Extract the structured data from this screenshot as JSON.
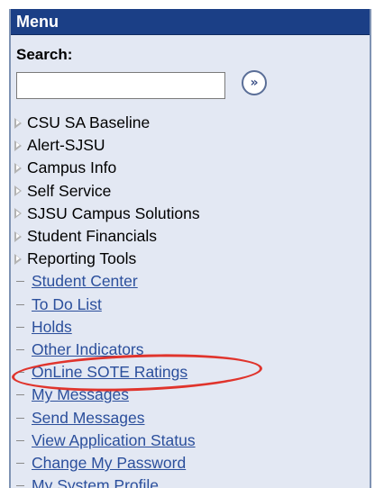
{
  "menu": {
    "title": "Menu",
    "search": {
      "label": "Search:",
      "value": "",
      "go_glyph": "»",
      "go_icon": "go-arrow-icon"
    },
    "folders": [
      "CSU SA Baseline",
      "Alert-SJSU",
      "Campus Info",
      "Self Service",
      "SJSU Campus Solutions",
      "Student Financials",
      "Reporting Tools"
    ],
    "links": [
      "Student Center",
      "To Do List",
      "Holds",
      "Other Indicators",
      "OnLine SOTE Ratings",
      "My Messages",
      "Send Messages",
      "View Application Status",
      "Change My Password",
      "My System Profile"
    ]
  },
  "colors": {
    "header_bg": "#1b3f86",
    "panel_bg": "#e3e8f3",
    "link": "#2b4f9c",
    "highlight_oval": "#e0342c"
  },
  "highlight": {
    "target": "OnLine SOTE Ratings"
  }
}
